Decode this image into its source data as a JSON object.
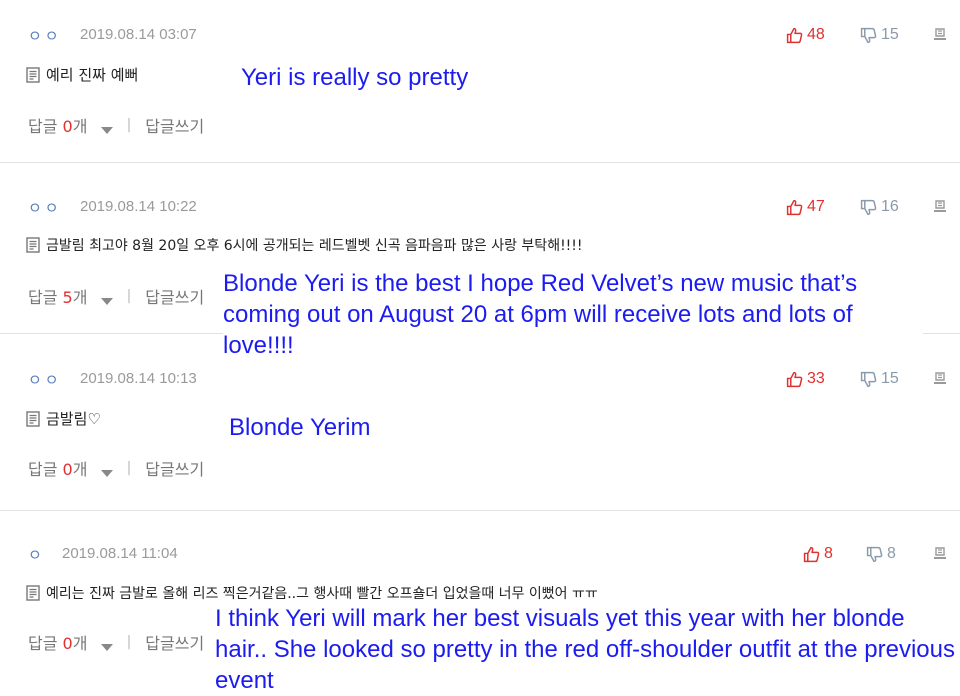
{
  "comments": [
    {
      "user": "ㅇㅇ",
      "date": "2019.08.14 03:07",
      "likes": "48",
      "dislikes": "15",
      "text": "예리 진짜 예뻐",
      "reply_label": "답글",
      "reply_count": "0",
      "reply_unit": "개",
      "write_reply": "답글쓰기",
      "translation": "Yeri is really so pretty"
    },
    {
      "user": "ㅇㅇ",
      "date": "2019.08.14 10:22",
      "likes": "47",
      "dislikes": "16",
      "text": "금발림 최고야 8월 20일 오후 6시에 공개되는 레드벨벳 신곡 음파음파 많은 사랑 부탁해!!!!",
      "reply_label": "답글",
      "reply_count": "5",
      "reply_unit": "개",
      "write_reply": "답글쓰기",
      "translation": "Blonde Yeri is the best I hope Red Velvet’s new music that’s coming out on August 20 at 6pm will receive lots and lots of love!!!!"
    },
    {
      "user": "ㅇㅇ",
      "date": "2019.08.14 10:13",
      "likes": "33",
      "dislikes": "15",
      "text": "금발림♡",
      "reply_label": "답글",
      "reply_count": "0",
      "reply_unit": "개",
      "write_reply": "답글쓰기",
      "translation": "Blonde Yerim"
    },
    {
      "user": "ㅇ",
      "date": "2019.08.14 11:04",
      "likes": "8",
      "dislikes": "8",
      "text": "예리는 진짜 금발로 올해 리즈 찍은거같음..그 행사때 빨간 오프숄더 입었을때 너무 이뻤어 ㅠㅠ",
      "reply_label": "답글",
      "reply_count": "0",
      "reply_unit": "개",
      "write_reply": "답글쓰기",
      "translation": "I think Yeri will mark her best visuals yet this year with her blonde hair.. She looked so pretty in the red off-shoulder outfit at the previous event"
    }
  ],
  "colors": {
    "like": "#e03030",
    "dislike": "#8a9aad",
    "translation": "#1c1cf0",
    "user": "#5b7fc2"
  },
  "icons": {
    "like": "thumbs-up-icon",
    "dislike": "thumbs-down-icon",
    "report": "report-icon",
    "doc": "document-icon",
    "caret": "caret-down-icon"
  }
}
